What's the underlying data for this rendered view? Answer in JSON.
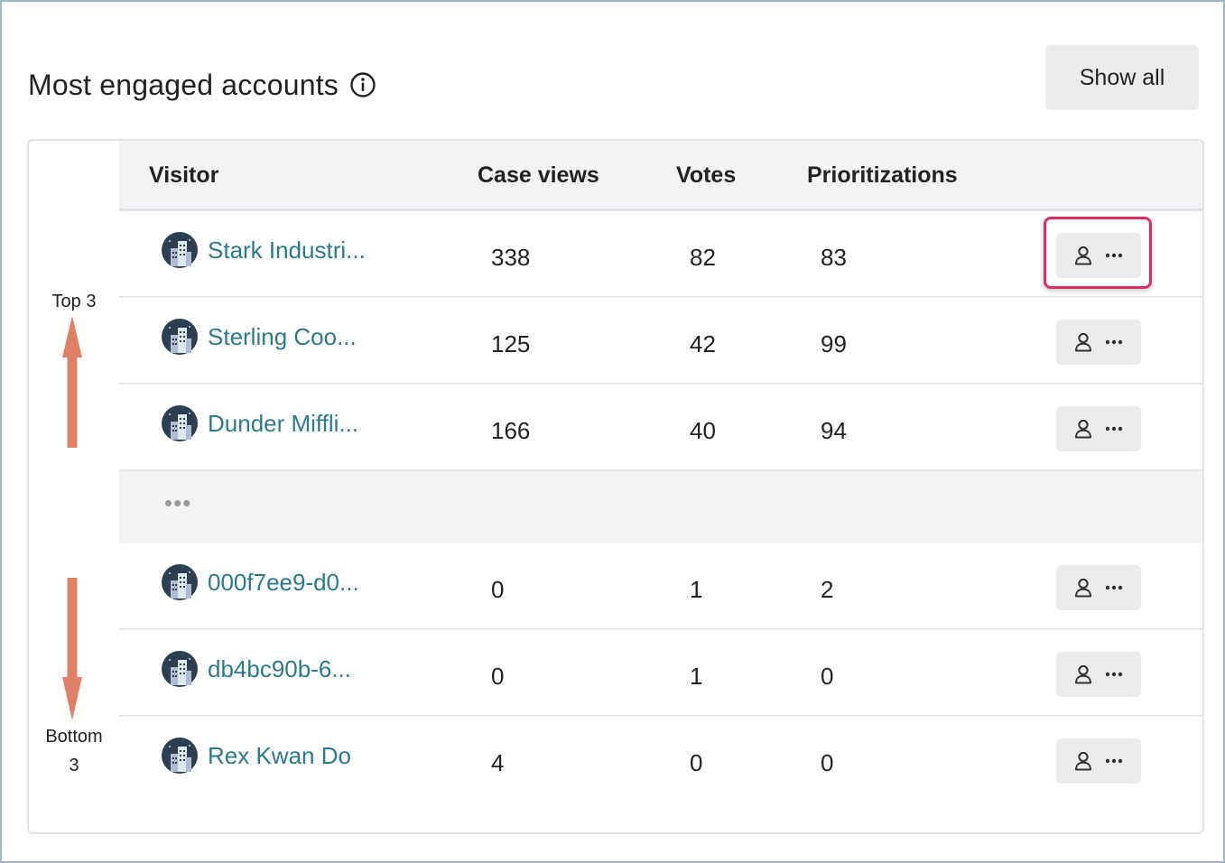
{
  "header": {
    "title": "Most engaged accounts",
    "show_all_label": "Show all"
  },
  "table": {
    "columns": [
      "Visitor",
      "Case views",
      "Votes",
      "Prioritizations"
    ],
    "rows": [
      {
        "name": "Stark Industri...",
        "case_views": "338",
        "votes": "82",
        "prioritizations": "83"
      },
      {
        "name": "Sterling Coo...",
        "case_views": "125",
        "votes": "42",
        "prioritizations": "99"
      },
      {
        "name": "Dunder Miffli...",
        "case_views": "166",
        "votes": "40",
        "prioritizations": "94"
      },
      {
        "name": "000f7ee9-d0...",
        "case_views": "0",
        "votes": "1",
        "prioritizations": "2"
      },
      {
        "name": "db4bc90b-6...",
        "case_views": "0",
        "votes": "1",
        "prioritizations": "0"
      },
      {
        "name": "Rex Kwan Do",
        "case_views": "4",
        "votes": "0",
        "prioritizations": "0"
      }
    ],
    "gap_indicator": "•••"
  },
  "annotations": {
    "top_label": "Top 3",
    "bottom_label_line1": "Bottom",
    "bottom_label_line2": "3",
    "arrow_color": "#e07f68",
    "highlight_color": "#d6315f"
  },
  "icons": {
    "info": "info-circle-icon",
    "avatar": "building-avatar-icon",
    "person": "person-icon",
    "more": "more-dots-icon"
  },
  "colors": {
    "link": "#2b7a8c",
    "header_bg": "#f3f3f5",
    "button_bg": "#ececef"
  }
}
